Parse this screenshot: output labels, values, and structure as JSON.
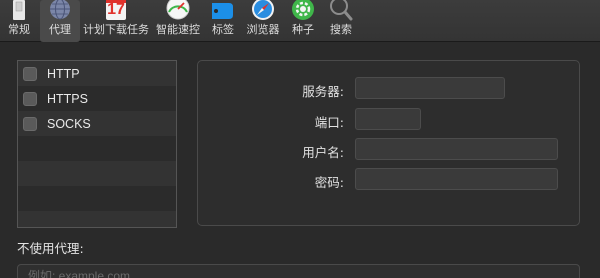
{
  "toolbar": {
    "items": [
      {
        "label": "常规",
        "icon": "switch-icon"
      },
      {
        "label": "代理",
        "icon": "globe-icon"
      },
      {
        "label": "计划下载任务",
        "icon": "calendar-icon",
        "calendar_day": "17"
      },
      {
        "label": "智能速控",
        "icon": "speedometer-icon"
      },
      {
        "label": "标签",
        "icon": "tag-icon"
      },
      {
        "label": "浏览器",
        "icon": "compass-icon"
      },
      {
        "label": "种子",
        "icon": "seed-gear-icon"
      },
      {
        "label": "搜索",
        "icon": "magnifier-icon"
      }
    ],
    "active_index": 1
  },
  "proxy_list": {
    "items": [
      {
        "label": "HTTP",
        "checked": false
      },
      {
        "label": "HTTPS",
        "checked": false
      },
      {
        "label": "SOCKS",
        "checked": false
      }
    ]
  },
  "details": {
    "server_label": "服务器:",
    "port_label": "端口:",
    "username_label": "用户名:",
    "password_label": "密码:",
    "server_value": "",
    "port_value": "",
    "username_value": "",
    "password_value": ""
  },
  "no_proxy": {
    "label": "不使用代理:",
    "placeholder": "例如: example.com",
    "value": ""
  },
  "colors": {
    "background": "#2a2a2a",
    "toolbar": "#383838",
    "calendar_red": "#e0322c",
    "tag_blue": "#1c8fe8",
    "seed_green": "#3fb64a",
    "safari_blue": "#2a8de0"
  }
}
